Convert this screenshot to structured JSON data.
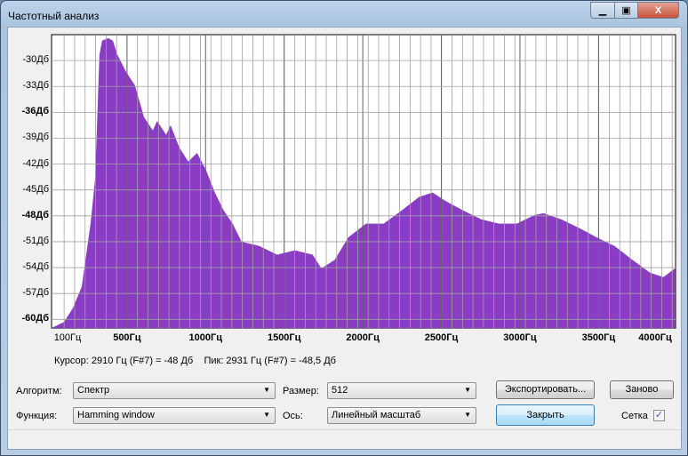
{
  "window": {
    "title": "Частотный анализ"
  },
  "chart_data": {
    "type": "area",
    "color": "#8a3cc4",
    "grid": true,
    "xlim": [
      20,
      3990
    ],
    "ylim": [
      -61,
      -27
    ],
    "x_ticks": [
      {
        "v": 100,
        "label": "100Гц"
      },
      {
        "v": 500,
        "label": "500Гц"
      },
      {
        "v": 1000,
        "label": "1000Гц"
      },
      {
        "v": 1500,
        "label": "1500Гц"
      },
      {
        "v": 2000,
        "label": "2000Гц"
      },
      {
        "v": 2500,
        "label": "2500Гц"
      },
      {
        "v": 3000,
        "label": "3000Гц"
      },
      {
        "v": 3500,
        "label": "3500Гц"
      },
      {
        "v": 4000,
        "label": "4000Гц"
      }
    ],
    "y_ticks": [
      {
        "v": -30,
        "label": "-30Дб"
      },
      {
        "v": -33,
        "label": "-33Дб"
      },
      {
        "v": -36,
        "label": "-36Дб"
      },
      {
        "v": -39,
        "label": "-39Дб"
      },
      {
        "v": -42,
        "label": "-42Дб"
      },
      {
        "v": -45,
        "label": "-45Дб"
      },
      {
        "v": -48,
        "label": "-48Дб"
      },
      {
        "v": -51,
        "label": "-51Дб"
      },
      {
        "v": -54,
        "label": "-54Дб"
      },
      {
        "v": -57,
        "label": "-57Дб"
      },
      {
        "v": -60,
        "label": "-60Дб"
      }
    ],
    "x": [
      20,
      99,
      155,
      212,
      268,
      297,
      325,
      342,
      381,
      410,
      438,
      494,
      551,
      607,
      664,
      692,
      749,
      777,
      833,
      890,
      946,
      1003,
      1059,
      1116,
      1172,
      1229,
      1342,
      1455,
      1568,
      1681,
      1737,
      1822,
      1907,
      2020,
      2133,
      2246,
      2359,
      2444,
      2528,
      2641,
      2754,
      2867,
      2980,
      3093,
      3150,
      3263,
      3376,
      3489,
      3602,
      3715,
      3828,
      3913,
      3986
    ],
    "y": [
      -61,
      -60.3,
      -58.7,
      -56.2,
      -48.9,
      -43.7,
      -29.3,
      -27.7,
      -27.4,
      -27.7,
      -29.3,
      -31.3,
      -32.9,
      -36.5,
      -38.1,
      -37,
      -38.6,
      -37.5,
      -40.1,
      -41.7,
      -40.7,
      -42.7,
      -45.3,
      -47.4,
      -48.9,
      -51,
      -51.5,
      -52.5,
      -52,
      -52.5,
      -54.1,
      -53.1,
      -50.5,
      -48.9,
      -48.9,
      -47.4,
      -45.8,
      -45.3,
      -46.3,
      -47.4,
      -48.4,
      -48.9,
      -48.9,
      -47.9,
      -47.7,
      -48.4,
      -49.4,
      -50.5,
      -51.5,
      -53.1,
      -54.6,
      -55.1,
      -54.1
    ]
  },
  "status": "Курсор: 2910 Гц (F#7) = -48 Дб    Пик: 2931 Гц (F#7) = -48,5 Дб",
  "controls": {
    "algorithm_label": "Алгоритм:",
    "algorithm_value": "Спектр",
    "function_label": "Функция:",
    "function_value": "Hamming window",
    "size_label": "Размер:",
    "size_value": "512",
    "axis_label": "Ось:",
    "axis_value": "Линейный масштаб",
    "export_label": "Экспортировать...",
    "replot_label": "Заново",
    "close_label": "Закрыть",
    "grid_label": "Сетка",
    "grid_checked": true
  }
}
